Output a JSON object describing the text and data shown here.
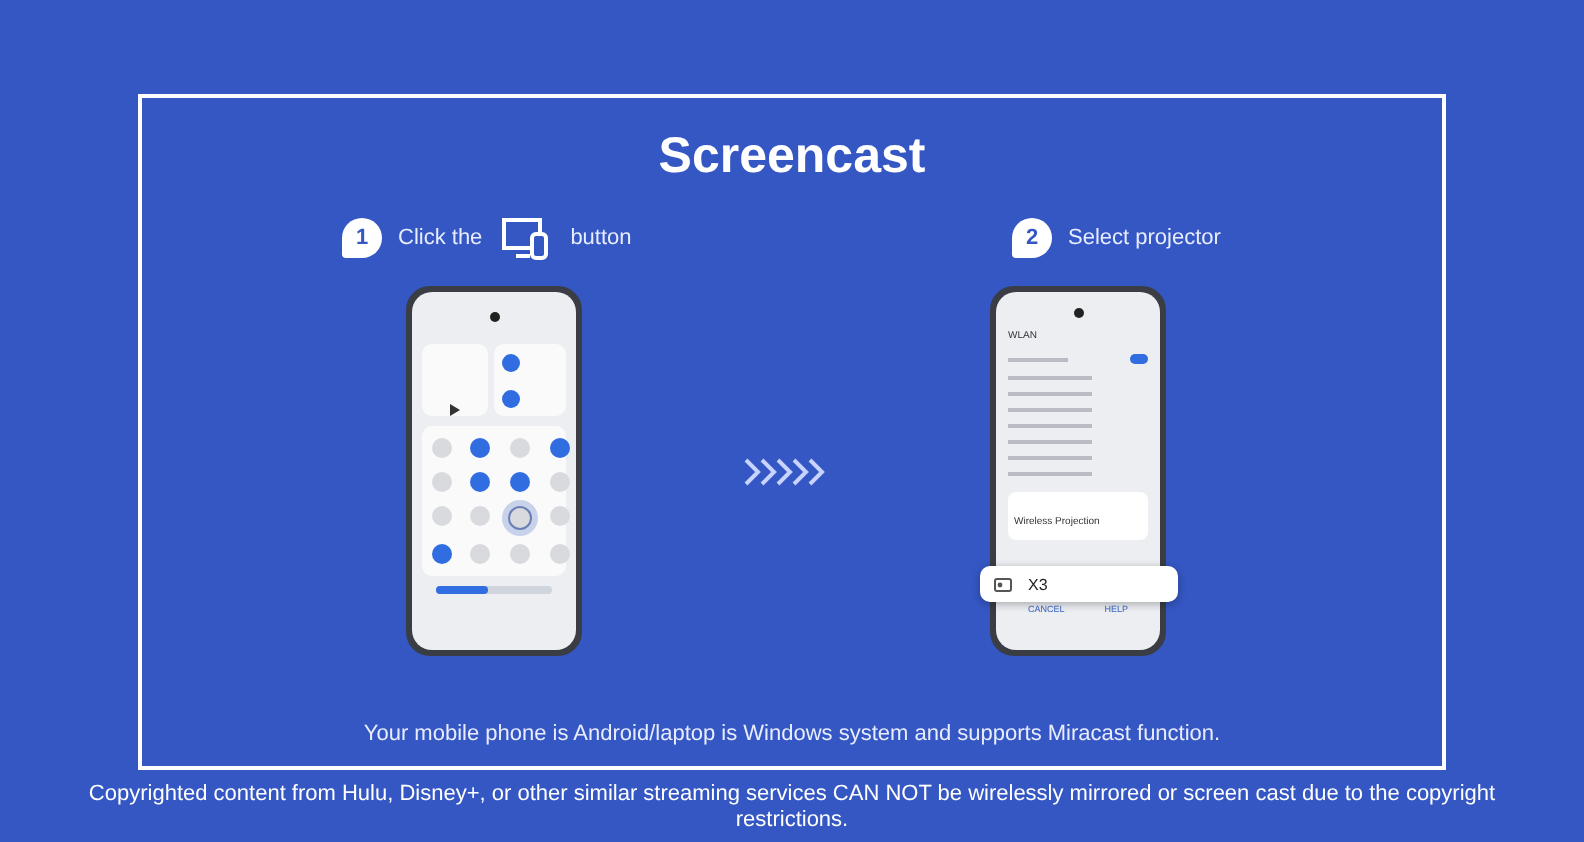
{
  "title": "Screencast",
  "steps": [
    {
      "number": "1",
      "kind": "with-icon",
      "label": "Click the",
      "suffix": "button"
    },
    {
      "number": "2",
      "kind": "plain",
      "label": "Select projector"
    }
  ],
  "quick_tiles": [
    {
      "on": false,
      "selected": false
    },
    {
      "on": true,
      "selected": false
    },
    {
      "on": false,
      "selected": false
    },
    {
      "on": true,
      "selected": false
    },
    {
      "on": false,
      "selected": false
    },
    {
      "on": true,
      "selected": false
    },
    {
      "on": true,
      "selected": false
    },
    {
      "on": false,
      "selected": false
    },
    {
      "on": false,
      "selected": false
    },
    {
      "on": false,
      "selected": false
    },
    {
      "on": false,
      "selected": true
    },
    {
      "on": false,
      "selected": false
    },
    {
      "on": true,
      "selected": false
    },
    {
      "on": false,
      "selected": false
    },
    {
      "on": false,
      "selected": false
    },
    {
      "on": false,
      "selected": false
    }
  ],
  "brightness": {
    "level": 0.45
  },
  "wlan": {
    "title": "WLAN",
    "on": true,
    "dialog_title": "Wireless Projection",
    "device": "X3",
    "buttons": [
      "CANCEL",
      "HELP"
    ]
  },
  "note": "Your mobile phone is Android/laptop is Windows system and supports Miracast function.",
  "copyright": "Copyrighted content from Hulu, Disney+, or other similar streaming services CAN NOT be wirelessly mirrored or screen cast due to the copyright restrictions."
}
